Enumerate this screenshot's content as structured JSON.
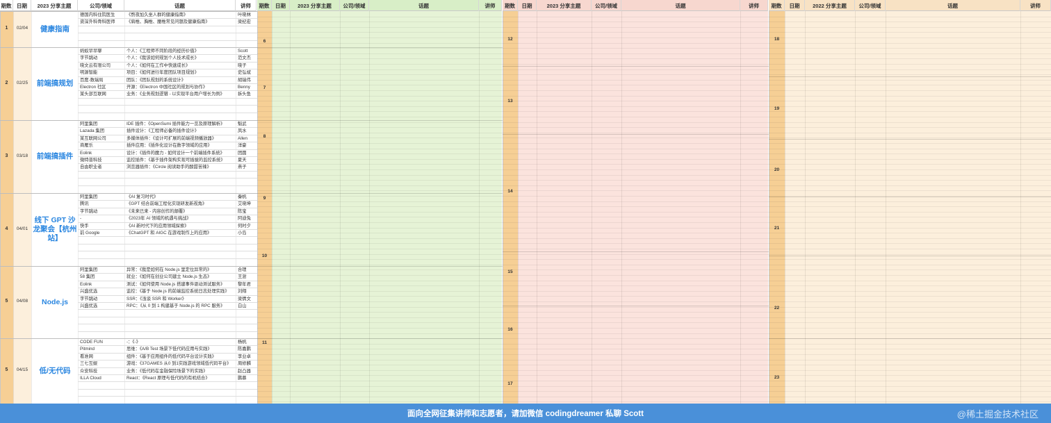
{
  "colors": {
    "orange": "#f6cf95",
    "green": "#e6f3d6",
    "pink": "#fbe3dd",
    "cream": "#fcefdc",
    "header_green": "#d8eec7",
    "header_pink": "#f7d7cf",
    "header_cream": "#f8e2c4",
    "topic_blue": "#2a86e0",
    "footer_bg": "#4a90d9"
  },
  "headers": {
    "block1": [
      "期数",
      "日期",
      "2023 分享主题",
      "公司/领域",
      "话题",
      "讲师"
    ],
    "block2": [
      "期数",
      "日期",
      "2023 分享主题",
      "公司/领域",
      "话题",
      "讲师"
    ],
    "block3": [
      "期数",
      "日期",
      "2023 分享主题",
      "公司/领域",
      "话题",
      "讲师"
    ],
    "block4": [
      "期数",
      "日期",
      "2022 分享主题",
      "公司/领域",
      "话题",
      "讲师"
    ]
  },
  "sessions": [
    {
      "num": "1",
      "date": "02/04",
      "title": "健康指南",
      "rows": [
        {
          "company": "德国内科住院医生",
          "topic": "《熬夜加久坐人群的健康指南》",
          "speaker": "叶晓林"
        },
        {
          "company": "资深外科骨科医师",
          "topic": "《肩椎、胸椎、腰椎常见问题及健康指南》",
          "speaker": "梁纪宏"
        }
      ]
    },
    {
      "num": "2",
      "date": "02/25",
      "title": "前端搞规划",
      "rows": [
        {
          "company": "蚂蚁早早聊",
          "topic": "个人：《工程师不同阶段的经历价值》",
          "speaker": "Scott"
        },
        {
          "company": "字节跳动",
          "topic": "个人：《我该如何规划个人技术成长》",
          "speaker": "范文杰"
        },
        {
          "company": "晓文云有限公司",
          "topic": "个人：《如何在工作中快速成长》",
          "speaker": "晓子"
        },
        {
          "company": "明源智能",
          "topic": "项目：《如何进行年度团队项目规划》",
          "speaker": "史弘斌"
        },
        {
          "company": "百度-数瑞局",
          "topic": "团队：《团队规划的系统设计》",
          "speaker": "胡瑞伟"
        },
        {
          "company": "Electron 社区",
          "topic": "开源：《Electron 中国社区的规划与协作》",
          "speaker": "Benny"
        },
        {
          "company": "某头部互联网",
          "topic": "业务：《业务规划逻辑 - 以实现平台用户增长为例》",
          "speaker": "拆头鱼"
        }
      ]
    },
    {
      "num": "3",
      "date": "03/18",
      "title": "前端搞插件",
      "rows": [
        {
          "company": "阿里集团",
          "topic": "IDE 插件：《OpenSumi 插件能力一览及原理解析》",
          "speaker": "魁武"
        },
        {
          "company": "Lazada 集团",
          "topic": "插件设计：《工程师必备的插件设计》",
          "speaker": "凤水"
        },
        {
          "company": "某互联网公司",
          "topic": "多媒体插件：《设计可扩展的前端视频播放器》",
          "speaker": "Allen"
        },
        {
          "company": "商雁乐",
          "topic": "插件应用：《插件化设计在数字领域的应用》",
          "speaker": "洋豪"
        },
        {
          "company": "Eolink",
          "topic": "设计：《插件的魔力 - 如何设计一个前端插件系统》",
          "speaker": "团圆"
        },
        {
          "company": "微特普科技",
          "topic": "监控插件：《基于插件架构实现可插拔的监控系统》",
          "speaker": "夏天"
        },
        {
          "company": "自由职业者",
          "topic": "浏览器插件：《Circle 阅读助手的酸甜苦辣》",
          "speaker": "燕子"
        }
      ]
    },
    {
      "num": "4",
      "date": "04/01",
      "title": "线下 GPT 沙龙聚会【杭州站】",
      "rows": [
        {
          "company": "阿里集团",
          "topic": "《AI 复习时代》",
          "speaker": "秦帆"
        },
        {
          "company": "腾讯",
          "topic": "《GPT 结合前端工程化实现研发新视角》",
          "speaker": "艾晓坤"
        },
        {
          "company": "字节跳动",
          "topic": "《未来已来 - 内容创作的颠覆》",
          "speaker": "陈宝"
        },
        {
          "company": "-",
          "topic": "《2023年 AI 领域的机遇与挑战》",
          "speaker": "阿迪兔"
        },
        {
          "company": "快手",
          "topic": "《AI 新时代下的应用领域探索》",
          "speaker": "何时夕"
        },
        {
          "company": "前 Google",
          "topic": "《ChatGPT 和 AIGC 在游戏制作上的应用》",
          "speaker": "小岛"
        }
      ]
    },
    {
      "num": "5",
      "date": "04/08",
      "title": "Node.js",
      "rows": [
        {
          "company": "阿里集团",
          "topic": "异常：《我是如何在 Node.js 里定位异常的》",
          "speaker": "合理"
        },
        {
          "company": "58 集团",
          "topic": "就业：《如何在创业公司建立 Node.js 生态》",
          "speaker": "王澍"
        },
        {
          "company": "Eolink",
          "topic": "测试：《如何使用 Node.js 搭建事件驱动测试服务》",
          "speaker": "黎年君"
        },
        {
          "company": "兴盛优选",
          "topic": "监控：《基于 Node.js 的前端监控系统日志处理实践》",
          "speaker": "刘翔"
        },
        {
          "company": "字节跳动",
          "topic": "SSR：《浅谈 SSR 和 Worker》",
          "speaker": "梁倩文"
        },
        {
          "company": "兴盛优选",
          "topic": "RPC：《从 0 到 1 构建基于 Node.js 的 RPC 服务》",
          "speaker": "白山"
        }
      ]
    },
    {
      "num": "5",
      "date": "04/15",
      "title": "低/无代码",
      "rows": [
        {
          "company": "CODE FUN",
          "topic": "-：《-》",
          "speaker": "杨帆"
        },
        {
          "company": "Pitmind",
          "topic": "思维：《A/B Test 场景下低代码应用与实践》",
          "speaker": "陈嘉鹏"
        },
        {
          "company": "看准网",
          "topic": "组件：《基于应用组件的低代码平台设计实践》",
          "speaker": "李业卓"
        },
        {
          "company": "三七互娱",
          "topic": "游戏：《37GAMES 从0 到1实践游戏领域低代码平台》",
          "speaker": "周修麟"
        },
        {
          "company": "众安科技",
          "topic": "业务：《低代码在金融保险场景下的实践》",
          "speaker": "赵凸器"
        },
        {
          "company": "ILLA Cloud",
          "topic": "React：《React 原理与低代码的有机结合》",
          "speaker": "鹏慕"
        }
      ]
    }
  ],
  "block2_nums": [
    "6",
    "7",
    "8",
    "9",
    "10",
    "11"
  ],
  "block3_nums": [
    "12",
    "13",
    "14",
    "15",
    "16",
    "17"
  ],
  "block4_nums": [
    "18",
    "19",
    "20",
    "21",
    "22",
    "23"
  ],
  "footer": {
    "text": "面向全网征集讲师和志愿者，请加微信 codingdreamer 私聊 Scott",
    "watermark": "@稀土掘金技术社区"
  }
}
